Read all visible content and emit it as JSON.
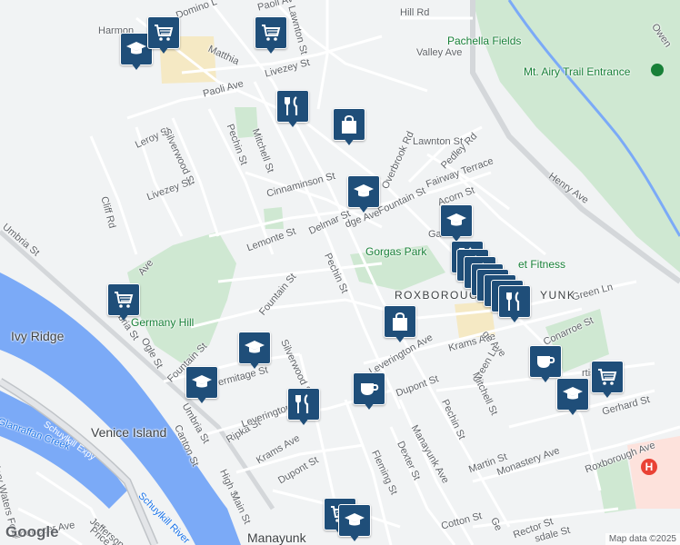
{
  "labels": {
    "streets": [
      {
        "id": "harmon",
        "text": "Harmon"
      },
      {
        "id": "domino",
        "text": "Domino L"
      },
      {
        "id": "paoli1",
        "text": "Paoli Av"
      },
      {
        "id": "lawnton1",
        "text": "Lawnton St"
      },
      {
        "id": "hillrd",
        "text": "Hill Rd"
      },
      {
        "id": "matthias",
        "text": "Matthia"
      },
      {
        "id": "valley",
        "text": "Valley Ave"
      },
      {
        "id": "livezey1",
        "text": "Livezey St"
      },
      {
        "id": "paoli2",
        "text": "Paoli Ave"
      },
      {
        "id": "lawnton2",
        "text": "Lawnton St"
      },
      {
        "id": "pedley",
        "text": "Pedley Rd"
      },
      {
        "id": "overbrook",
        "text": "Overbrook Rd"
      },
      {
        "id": "fairway",
        "text": "Fairway Terrace"
      },
      {
        "id": "leroy",
        "text": "Leroy St"
      },
      {
        "id": "silverwood1",
        "text": "Silverwood St"
      },
      {
        "id": "pechin1",
        "text": "Pechin St"
      },
      {
        "id": "mitchell1",
        "text": "Mitchell St"
      },
      {
        "id": "cinnaminson",
        "text": "Cinnaminson St"
      },
      {
        "id": "fountain1",
        "text": "Fountain St"
      },
      {
        "id": "acorn",
        "text": "Acorn St"
      },
      {
        "id": "henry",
        "text": "Henry Ave"
      },
      {
        "id": "livezey2",
        "text": "Livezey St"
      },
      {
        "id": "cliff",
        "text": "Cliff Rd"
      },
      {
        "id": "delmar",
        "text": "Delmar St"
      },
      {
        "id": "ridge1",
        "text": "dge Ave"
      },
      {
        "id": "umbria1",
        "text": "Umbria St"
      },
      {
        "id": "lemonte",
        "text": "Lemonte St"
      },
      {
        "id": "pechin2",
        "text": "Pechin St"
      },
      {
        "id": "ave1",
        "text": "Ave"
      },
      {
        "id": "greenln1",
        "text": "Green Ln"
      },
      {
        "id": "fountain2",
        "text": "Fountain St"
      },
      {
        "id": "umbria2",
        "text": "Umbria St"
      },
      {
        "id": "ogle",
        "text": "Ogle St"
      },
      {
        "id": "fountain3",
        "text": "Fountain St"
      },
      {
        "id": "silverwood2",
        "text": "Silverwood St"
      },
      {
        "id": "leverington1",
        "text": "Leverington Ave"
      },
      {
        "id": "krams1",
        "text": "Krams Ave"
      },
      {
        "id": "ridge2",
        "text": "ge Ave"
      },
      {
        "id": "conarroe",
        "text": "Conarroe St"
      },
      {
        "id": "hermitage",
        "text": "Hermitage St"
      },
      {
        "id": "dupont1",
        "text": "Dupont St"
      },
      {
        "id": "greenln2",
        "text": "Green Ln"
      },
      {
        "id": "mitchell2",
        "text": "Mitchell St"
      },
      {
        "id": "umbria3",
        "text": "Umbria St"
      },
      {
        "id": "pechin3",
        "text": "Pechin St"
      },
      {
        "id": "manayunk",
        "text": "Manayunk Ave"
      },
      {
        "id": "ripka",
        "text": "Ripka St"
      },
      {
        "id": "leverington2",
        "text": "Leverington"
      },
      {
        "id": "gerhard",
        "text": "Gerhard St"
      },
      {
        "id": "canton",
        "text": "Canton St"
      },
      {
        "id": "dexter",
        "text": "Dexter St"
      },
      {
        "id": "martin",
        "text": "Martin St"
      },
      {
        "id": "monastery",
        "text": "Monastery Ave"
      },
      {
        "id": "krams2",
        "text": "Krams Ave"
      },
      {
        "id": "dupont2",
        "text": "Dupont St"
      },
      {
        "id": "roxave",
        "text": "Roxborough Ave"
      },
      {
        "id": "high",
        "text": "High St"
      },
      {
        "id": "fleming",
        "text": "Fleming St"
      },
      {
        "id": "main",
        "text": "Main St"
      },
      {
        "id": "jefferson",
        "text": "Jefferson St"
      },
      {
        "id": "cotton",
        "text": "Cotton St"
      },
      {
        "id": "rector",
        "text": "Rector St"
      },
      {
        "id": "ebenezer",
        "text": "Ebenezer Ave"
      },
      {
        "id": "price",
        "text": "Price St"
      },
      {
        "id": "owen",
        "text": "Owen"
      },
      {
        "id": "marywaters",
        "text": "Mary Waters Ford"
      },
      {
        "id": "sdale",
        "text": "sdale St"
      },
      {
        "id": "ge",
        "text": "Ge"
      },
      {
        "id": "ga",
        "text": "Ga"
      },
      {
        "id": "rtis",
        "text": "rtis"
      }
    ],
    "parks": [
      {
        "id": "pachella",
        "text": "Pachella Fields"
      },
      {
        "id": "mtairy",
        "text": "Mt. Airy Trail Entrance"
      },
      {
        "id": "gorgas",
        "text": "Gorgas Park"
      },
      {
        "id": "germany",
        "text": "Germany Hill"
      },
      {
        "id": "fitness",
        "text": "et Fitness"
      }
    ],
    "places": [
      {
        "id": "ivyridge",
        "text": "Ivy Ridge"
      },
      {
        "id": "venice",
        "text": "Venice Island"
      },
      {
        "id": "manayunk_place",
        "text": "Manayunk"
      }
    ],
    "neighborhoods": [
      {
        "id": "roxborough",
        "text": "ROXBOROUGH"
      },
      {
        "id": "yunk",
        "text": "YUNK"
      }
    ],
    "water": [
      {
        "id": "glanraffan",
        "text": "Glanraffan Creek"
      },
      {
        "id": "schuylkill",
        "text": "Schuylkill River"
      }
    ],
    "highways": [
      {
        "id": "expy",
        "text": "Schuylkill Expy"
      }
    ]
  },
  "markers": [
    {
      "type": "education-icon"
    },
    {
      "type": "shopping-cart-icon"
    },
    {
      "type": "shopping-cart-icon"
    },
    {
      "type": "restaurant-icon"
    },
    {
      "type": "shopping-bag-icon"
    },
    {
      "type": "education-icon"
    },
    {
      "type": "education-icon"
    },
    {
      "type": "shopping-cart-icon"
    },
    {
      "type": "restaurant-icon"
    },
    {
      "type": "restaurant-icon"
    },
    {
      "type": "restaurant-icon"
    },
    {
      "type": "restaurant-icon"
    },
    {
      "type": "shopping-bag-icon"
    },
    {
      "type": "education-icon"
    },
    {
      "type": "education-icon"
    },
    {
      "type": "restaurant-icon"
    },
    {
      "type": "cafe-icon"
    },
    {
      "type": "cafe-icon"
    },
    {
      "type": "shopping-cart-icon"
    },
    {
      "type": "education-icon"
    },
    {
      "type": "shopping-cart-icon"
    },
    {
      "type": "education-icon"
    }
  ],
  "hospital_symbol": "H",
  "brand": "Google",
  "attribution": "Map data ©2025",
  "colors": {
    "marker": "#1f4e79",
    "park": "#c8e6c9",
    "water": "#7baaf7",
    "road": "#ffffff",
    "highway": "#c0c4c8",
    "hospital": "#e94235"
  }
}
